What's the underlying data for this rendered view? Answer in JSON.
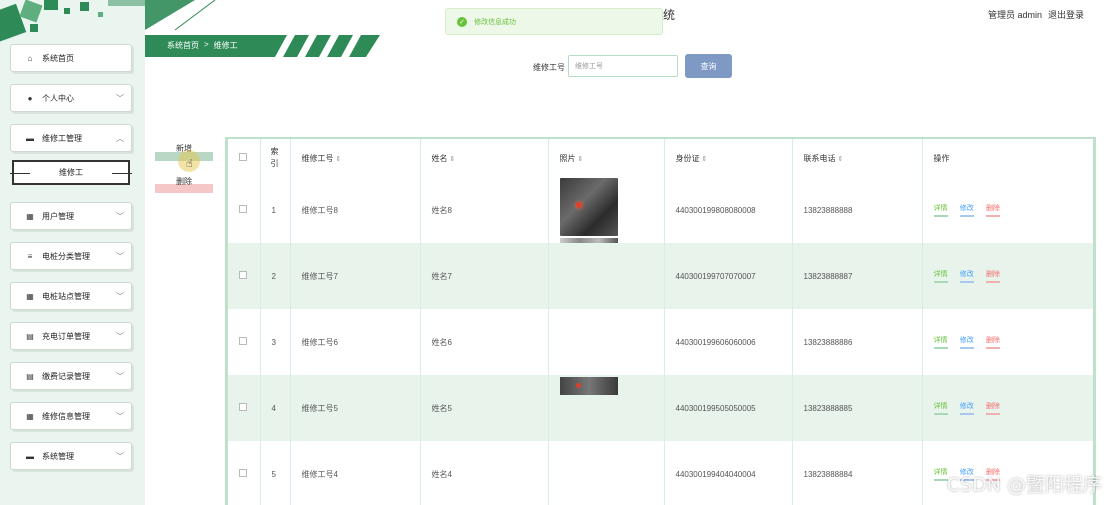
{
  "header": {
    "title_fragment": "统",
    "admin_text": "管理员 admin",
    "logout": "退出登录",
    "breadcrumb": [
      "系统首页",
      ">",
      "维修工"
    ]
  },
  "toast": {
    "message": "修改信息成功",
    "icon": "check-icon"
  },
  "sidebar": {
    "items": [
      {
        "label": "系统首页",
        "icon": "⌂",
        "chevron": false
      },
      {
        "label": "个人中心",
        "icon": "●",
        "chevron": true
      },
      {
        "label": "维修工管理",
        "icon": "▬",
        "chevron": true,
        "expanded": true
      },
      {
        "label": "用户管理",
        "icon": "▦",
        "chevron": true
      },
      {
        "label": "电桩分类管理",
        "icon": "≡",
        "chevron": true
      },
      {
        "label": "电桩站点管理",
        "icon": "▦",
        "chevron": true
      },
      {
        "label": "充电订单管理",
        "icon": "▤",
        "chevron": true
      },
      {
        "label": "缴费记录管理",
        "icon": "▤",
        "chevron": true
      },
      {
        "label": "维修信息管理",
        "icon": "▦",
        "chevron": true
      },
      {
        "label": "系统管理",
        "icon": "▬",
        "chevron": true
      }
    ],
    "sub_item": "维修工"
  },
  "search": {
    "label": "维修工号",
    "placeholder": "维修工号",
    "button": "查询"
  },
  "actions": {
    "add": "新增",
    "delete": "删除"
  },
  "table": {
    "headers": {
      "index": "索引",
      "worker_no": "维修工号",
      "name": "姓名",
      "photo": "照片",
      "id_card": "身份证",
      "phone": "联系电话",
      "ops": "操作"
    },
    "ops": {
      "detail": "详情",
      "edit": "修改",
      "delete": "删除"
    },
    "rows": [
      {
        "index": "1",
        "worker_no": "维修工号8",
        "name": "姓名8",
        "id_card": "440300199808080008",
        "phone": "13823888888",
        "photo": "full"
      },
      {
        "index": "2",
        "worker_no": "维修工号7",
        "name": "姓名7",
        "id_card": "440300199707070007",
        "phone": "13823888887",
        "photo": "none"
      },
      {
        "index": "3",
        "worker_no": "维修工号6",
        "name": "姓名6",
        "id_card": "440300199606060006",
        "phone": "13823888886",
        "photo": "none"
      },
      {
        "index": "4",
        "worker_no": "维修工号5",
        "name": "姓名5",
        "id_card": "440300199505050005",
        "phone": "13823888885",
        "photo": "partial"
      },
      {
        "index": "5",
        "worker_no": "维修工号4",
        "name": "姓名4",
        "id_card": "440300199404040004",
        "phone": "13823888884",
        "photo": "none"
      }
    ]
  },
  "watermark": "CSDN @暨阳程序",
  "colors": {
    "brand": "#2e8b57",
    "sidebar_bg": "#e9f5ee",
    "row_alt": "#e8f3ec",
    "search_btn": "#7d99c4"
  }
}
